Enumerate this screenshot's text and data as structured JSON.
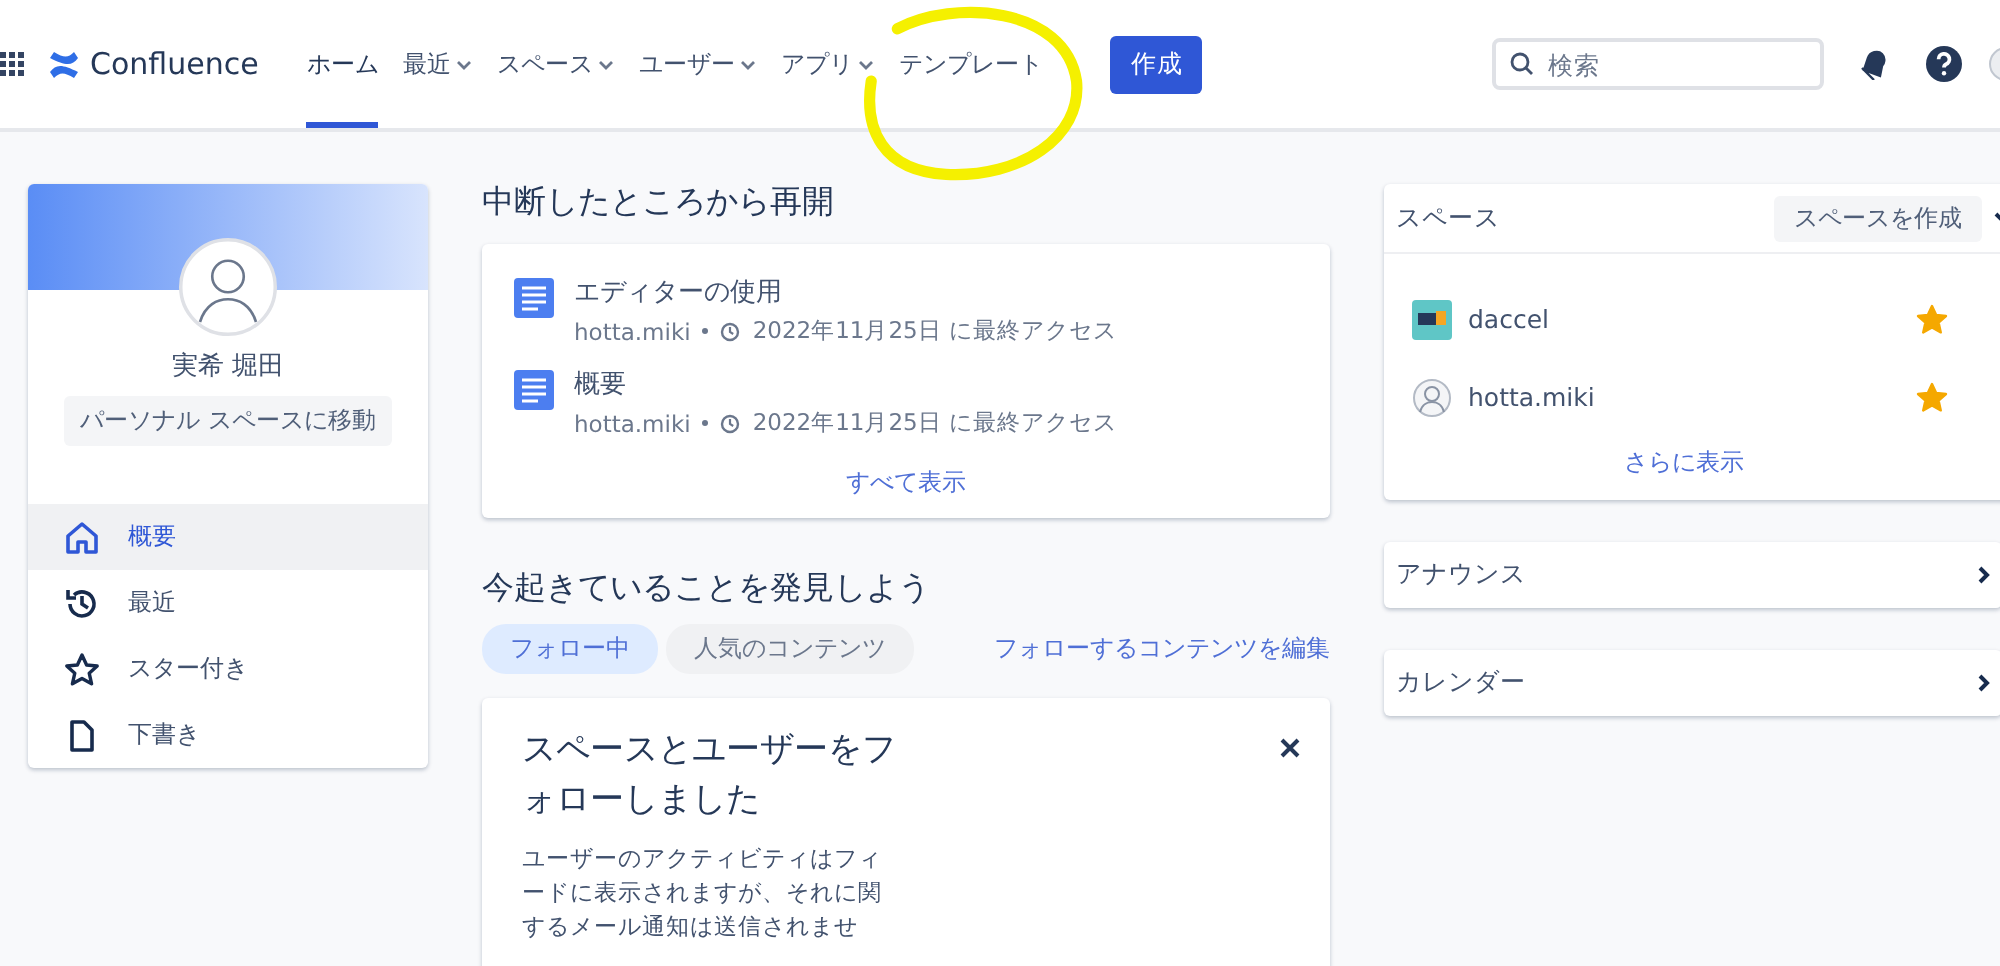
{
  "header": {
    "app_name": "Confluence",
    "nav": [
      {
        "label": "ホーム",
        "selected": true,
        "dropdown": false
      },
      {
        "label": "最近",
        "selected": false,
        "dropdown": true
      },
      {
        "label": "スペース",
        "selected": false,
        "dropdown": true
      },
      {
        "label": "ユーザー",
        "selected": false,
        "dropdown": true
      },
      {
        "label": "アプリ",
        "selected": false,
        "dropdown": true
      },
      {
        "label": "テンプレート",
        "selected": false,
        "dropdown": false
      }
    ],
    "create_button": "作成",
    "search": {
      "placeholder": "検索"
    }
  },
  "profile": {
    "name": "実希 堀田",
    "personal_space_button": "パーソナル スペースに移動",
    "menu": [
      {
        "label": "概要",
        "selected": true
      },
      {
        "label": "最近",
        "selected": false
      },
      {
        "label": "スター付き",
        "selected": false
      },
      {
        "label": "下書き",
        "selected": false
      }
    ]
  },
  "continue": {
    "title": "中断したところから再開",
    "items": [
      {
        "title": "エディターの使用",
        "author": "hotta.miki",
        "accessed": "2022年11月25日 に最終アクセス"
      },
      {
        "title": "概要",
        "author": "hotta.miki",
        "accessed": "2022年11月25日 に最終アクセス"
      }
    ],
    "show_all": "すべて表示"
  },
  "discover": {
    "title": "今起きていることを発見しよう",
    "tabs": [
      {
        "label": "フォロー中",
        "selected": true
      },
      {
        "label": "人気のコンテンツ",
        "selected": false
      }
    ],
    "edit_link": "フォローするコンテンツを編集",
    "card": {
      "title": "スペースとユーザーをフォローしました",
      "body": "ユーザーのアクティビティはフィードに表示されますが、それに関するメール通知は送信されませ"
    }
  },
  "spaces": {
    "title": "スペース",
    "create_button": "スペースを作成",
    "items": [
      {
        "name": "daccel",
        "kind": "space",
        "starred": true
      },
      {
        "name": "hotta.miki",
        "kind": "personal",
        "starred": true
      }
    ],
    "more": "さらに表示"
  },
  "panels": [
    {
      "title": "アナウンス"
    },
    {
      "title": "カレンダー"
    }
  ]
}
